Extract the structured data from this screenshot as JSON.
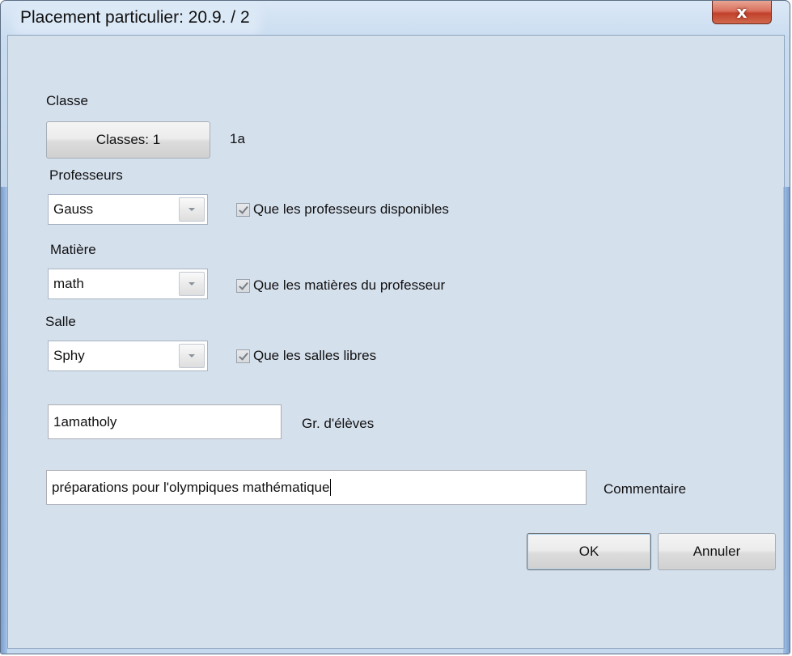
{
  "window": {
    "title": "Placement particulier:  20.9. / 2",
    "close_label": "x"
  },
  "classe": {
    "label": "Classe",
    "button_label": "Classes: 1",
    "value": "1a"
  },
  "professeurs": {
    "label": "Professeurs",
    "selected": "Gauss",
    "checkbox_label": "Que les professeurs disponibles",
    "checked": true
  },
  "matiere": {
    "label": "Matière",
    "selected": "math",
    "checkbox_label": "Que les matières du professeur",
    "checked": true
  },
  "salle": {
    "label": "Salle",
    "selected": "Sphy",
    "checkbox_label": "Que les salles libres",
    "checked": true
  },
  "groupe": {
    "value": "1amatholy",
    "label": "Gr. d'élèves"
  },
  "commentaire": {
    "value": "préparations pour l'olympiques mathématique",
    "label": "Commentaire"
  },
  "buttons": {
    "ok": "OK",
    "cancel": "Annuler"
  }
}
